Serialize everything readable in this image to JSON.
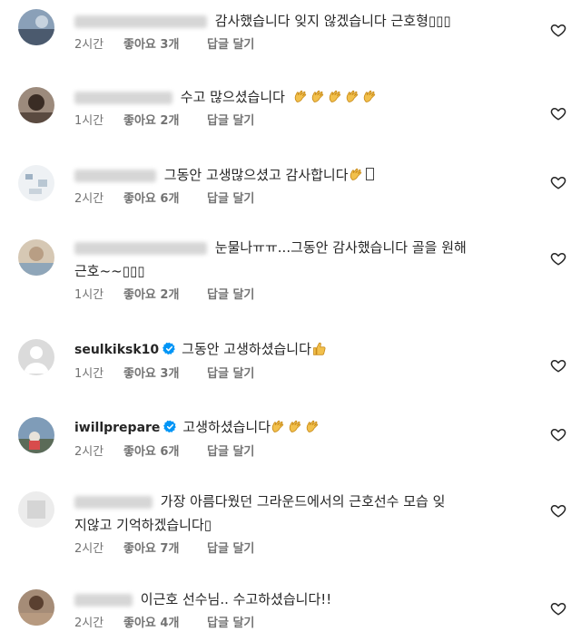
{
  "comments": [
    {
      "username": "",
      "verified": false,
      "text": "감사했습니다 잊지 않겠습니다 근호형▯▯▯",
      "time": "2시간",
      "likes": "좋아요 3개",
      "reply": "답글 달기",
      "emoji": ""
    },
    {
      "username": "",
      "verified": false,
      "text": "수고 많으셨습니다",
      "time": "1시간",
      "likes": "좋아요 2개",
      "reply": "답글 달기",
      "emoji": "clap-icon x5"
    },
    {
      "username": "",
      "verified": false,
      "text": "그동안 고생많으셨고 감사합니다",
      "time": "2시간",
      "likes": "좋아요 6개",
      "reply": "답글 달기",
      "emoji": "clap-icon"
    },
    {
      "username": "",
      "verified": false,
      "text_line1": "눈물나ㅠㅠ...그동안 감사했습니다 골을 원해",
      "text_line2": "근호~~▯▯▯",
      "time": "1시간",
      "likes": "좋아요 2개",
      "reply": "답글 달기"
    },
    {
      "username": "seulkiksk10",
      "verified": true,
      "text": "그동안 고생하셨습니다",
      "time": "1시간",
      "likes": "좋아요 3개",
      "reply": "답글 달기",
      "emoji": "thumbs-up-icon"
    },
    {
      "username": "iwillprepare",
      "verified": true,
      "text": "고생하셨습니다",
      "time": "2시간",
      "likes": "좋아요 6개",
      "reply": "답글 달기",
      "emoji": "clap-icon x3"
    },
    {
      "username": "",
      "verified": false,
      "text_line1": "가장 아름다웠던 그라운드에서의 근호선수 모습 잊",
      "text_line2": "지않고 기억하겠습니다▯",
      "time": "2시간",
      "likes": "좋아요 7개",
      "reply": "답글 달기"
    },
    {
      "username": "",
      "verified": false,
      "text": "이근호 선수님.. 수고하셨습니다!!",
      "time": "2시간",
      "likes": "좋아요 4개",
      "reply": "답글 달기"
    }
  ],
  "colors": {
    "text": "#262626",
    "meta": "#737373",
    "verified": "#0095f6",
    "emoji": "#f2c04c"
  }
}
